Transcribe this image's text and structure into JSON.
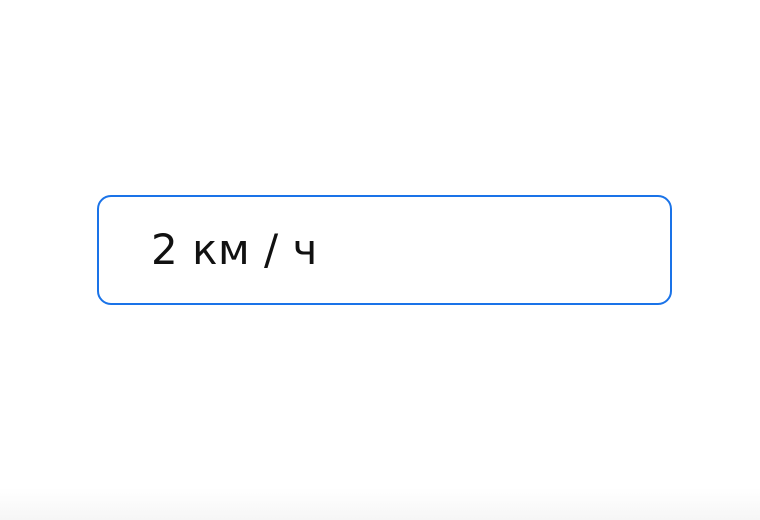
{
  "input": {
    "value": "2 км / ч",
    "border_color": "#1a73e8",
    "text_color": "#111111"
  }
}
